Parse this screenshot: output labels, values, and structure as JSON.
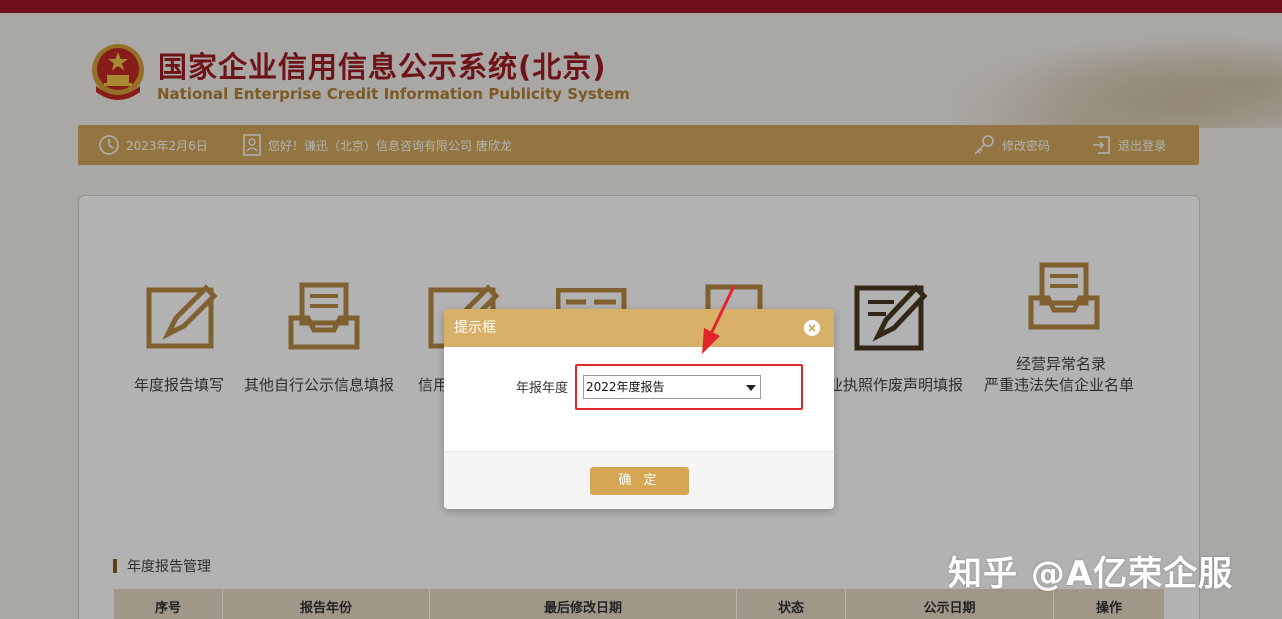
{
  "header": {
    "title_cn": "国家企业信用信息公示系统(北京)",
    "title_en": "National Enterprise Credit Information Publicity System"
  },
  "userbar": {
    "date": "2023年2月6日",
    "greeting": "您好！谦迅（北京）信息咨询有限公司 唐欣龙",
    "change_password": "修改密码",
    "logout": "退出登录"
  },
  "functions": [
    {
      "label": "年度报告填写",
      "icon": "edit-form-icon"
    },
    {
      "label": "其他自行公示信息填报",
      "icon": "inbox-document-icon"
    },
    {
      "label": "信用",
      "icon": "edit-form-icon"
    },
    {
      "label": "",
      "icon": "document-icon"
    },
    {
      "label": "",
      "icon": "document-icon"
    },
    {
      "label": "业执照作废声明填报",
      "icon": "edit-form-icon"
    },
    {
      "label": "经营异常名录",
      "label2": "严重违法失信企业名单",
      "icon": "inbox-document-icon"
    }
  ],
  "section": {
    "title": "年度报告管理"
  },
  "table": {
    "columns": [
      "序号",
      "报告年份",
      "最后修改日期",
      "状态",
      "公示日期",
      "操作"
    ]
  },
  "dialog": {
    "title": "提示框",
    "close": "×",
    "field_label": "年报年度",
    "select_value": "2022年度报告",
    "ok_label": "确 定"
  },
  "watermark": "知乎 @A亿荣企服",
  "colors": {
    "brand_red": "#a3162a",
    "gold": "#d2a85c",
    "highlight": "#e1262b"
  }
}
